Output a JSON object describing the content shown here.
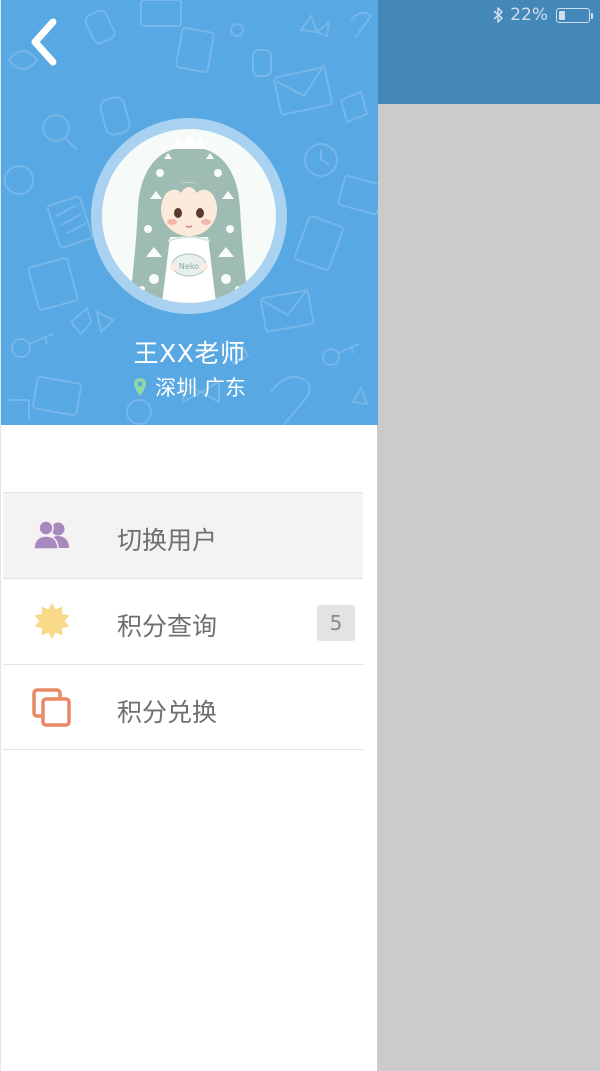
{
  "status_bar": {
    "battery_percent_label": "22%",
    "battery_level": 0.22,
    "icons": [
      "bluetooth-icon",
      "battery-icon"
    ]
  },
  "header": {
    "back_icon": "chevron-left-icon",
    "avatar_badge_text": "Neko",
    "user_name": "王XX老师",
    "location_icon": "location-pin-icon",
    "location": "深圳 广东"
  },
  "menu": {
    "items": [
      {
        "label": "切换用户",
        "icon": "users-icon",
        "active": true
      },
      {
        "label": "积分查询",
        "icon": "sun-badge-icon",
        "badge": "5"
      },
      {
        "label": "积分兑换",
        "icon": "copy-squares-icon"
      }
    ]
  },
  "colors": {
    "header_blue": "#58a8e3",
    "backdrop_blue": "#4487b9",
    "backdrop_gray": "#cbcbcb",
    "users_icon": "#a889bd",
    "sun_icon": "#f7d988",
    "exchange_icon": "#e98a64",
    "location_icon": "#8fd8a4"
  }
}
